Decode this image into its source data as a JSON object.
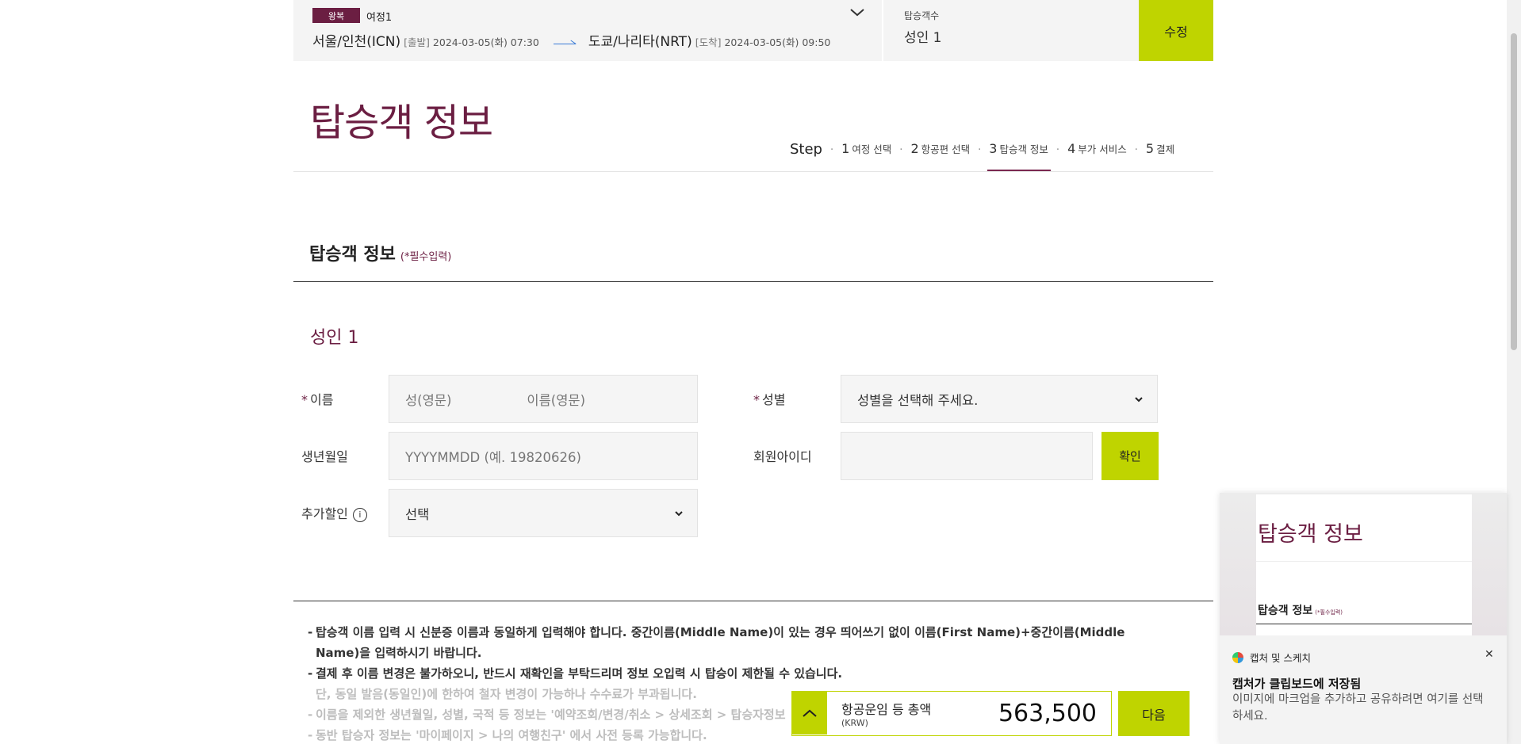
{
  "trip": {
    "badge": "왕복",
    "label": "여정1",
    "from_city": "서울/인천(ICN)",
    "from_tag": "[출발]",
    "from_datetime": "2024-03-05(화) 07:30",
    "to_city": "도쿄/나리타(NRT)",
    "to_tag": "[도착]",
    "to_datetime": "2024-03-05(화) 09:50"
  },
  "passengers": {
    "label": "탑승객수",
    "value": "성인 1",
    "edit_label": "수정"
  },
  "page_title": "탑승객 정보",
  "steps": {
    "word": "Step",
    "items": [
      {
        "num": "1",
        "label": "여정 선택"
      },
      {
        "num": "2",
        "label": "항공편 선택"
      },
      {
        "num": "3",
        "label": "탑승객 정보"
      },
      {
        "num": "4",
        "label": "부가 서비스"
      },
      {
        "num": "5",
        "label": "결제"
      }
    ],
    "active_index": 2
  },
  "section": {
    "title": "탑승객 정보",
    "required_note": "(*필수입력)"
  },
  "adult": {
    "title": "성인 1",
    "name_label": "이름",
    "surname_placeholder": "성(영문)",
    "given_placeholder": "이름(영문)",
    "gender_label": "성별",
    "gender_value": "성별을 선택해 주세요.",
    "birth_label": "생년월일",
    "birth_placeholder": "YYYYMMDD (예. 19820626)",
    "member_label": "회원아이디",
    "member_value": "",
    "confirm_label": "확인",
    "discount_label": "추가할인",
    "discount_value": "선택"
  },
  "notes": [
    "탑승객 이름 입력 시 신분증 이름과 동일하게 입력해야 합니다. 중간이름(Middle Name)이 있는 경우 띄어쓰기 없이 이름(First Name)+중간이름(Middle Name)을 입력하시기 바랍니다.",
    "결제 후 이름 변경은 불가하오니, 반드시 재확인을 부탁드리며 정보 오입력 시 탑승이 제한될 수 있습니다.",
    "단, 동일 발음(동일인)에 한하여 철자 변경이 가능하나 수수료가 부과됩니다.",
    "이름을 제외한 생년월일, 성별, 국적 등 정보는 '예약조회/변경/취소 > 상세조회 > 탑승자정보",
    "동반 탑승자 정보는 '마이페이지 > 나의 여행친구' 에서 사전 등록 가능합니다."
  ],
  "total": {
    "label": "항공운임 등 총액",
    "currency": "(KRW)",
    "amount": "563,500",
    "next_label": "다음"
  },
  "snip": {
    "preview_title": "탑승객 정보",
    "preview_section": "탑승객 정보",
    "preview_required": "(*필수입력)",
    "app_name": "캡처 및 스케치",
    "title": "캡처가 클립보드에 저장됨",
    "body": "이미지에 마크업을 추가하고 공유하려면 여기를 선택하세요."
  },
  "colors": {
    "brand": "#6b1e42",
    "accent": "#bfd400"
  }
}
